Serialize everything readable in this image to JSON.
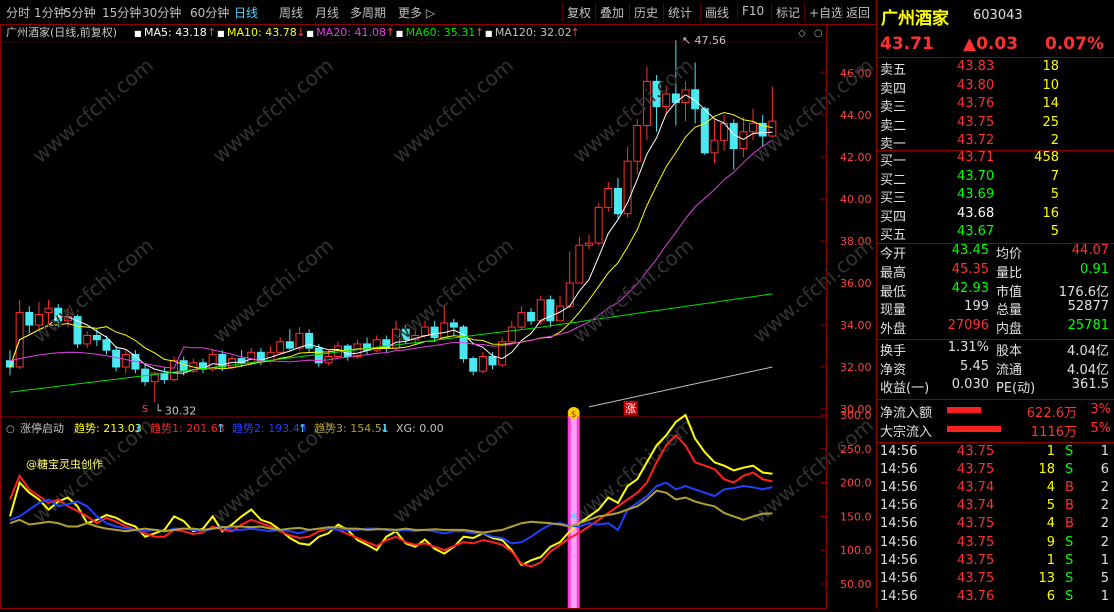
{
  "toolbar": {
    "periods": [
      "分时",
      "1分钟",
      "5分钟",
      "15分钟",
      "30分钟",
      "60分钟",
      "日线",
      "周线",
      "月线",
      "多周期",
      "更多"
    ],
    "active": "日线",
    "actions": [
      "复权",
      "叠加",
      "历史",
      "统计",
      "画线",
      "F10",
      "标记",
      "+自选",
      "返回"
    ]
  },
  "main_chart": {
    "title": "广州酒家(日线,前复权)",
    "ma": [
      {
        "label": "MA5: 43.18",
        "arrow": "↑",
        "color": "#ffffff"
      },
      {
        "label": "MA10: 43.78",
        "arrow": "↓",
        "color": "#ffff00"
      },
      {
        "label": "MA20: 41.08",
        "arrow": "↑",
        "color": "#e040e0"
      },
      {
        "label": "MA60: 35.31",
        "arrow": "↑",
        "color": "#00e000"
      },
      {
        "label": "MA120: 32.02",
        "arrow": "↑",
        "color": "#c0c0c0"
      }
    ],
    "y_ticks": [
      "46.00",
      "44.00",
      "42.00",
      "40.00",
      "38.00",
      "36.00",
      "34.00",
      "32.00",
      "30.00"
    ],
    "high_marker": "47.56",
    "low_marker": "30.32",
    "limit_up_marker": "涨",
    "s_marker": "S"
  },
  "indicator": {
    "name": "涨停启动",
    "lines": [
      {
        "label": "趋势: 213.03",
        "arrow": "↓",
        "color": "#ffff00"
      },
      {
        "label": "趋势1: 201.63",
        "arrow": "↑",
        "color": "#ff2020"
      },
      {
        "label": "趋势2: 193.45",
        "arrow": "↑",
        "color": "#2040ff"
      },
      {
        "label": "趋势3: 154.51",
        "arrow": "↓",
        "color": "#b0a030"
      },
      {
        "label": "XG: 0.00",
        "arrow": "",
        "color": "#c0c0c0"
      }
    ],
    "author": "@糖宝灵虫创作",
    "y_ticks": [
      "300.0",
      "250.0",
      "200.0",
      "150.0",
      "100.0",
      "50.00"
    ]
  },
  "stock": {
    "name": "广州酒家",
    "code": "603043",
    "price": "43.71",
    "change": "▲0.03",
    "pct": "0.07%"
  },
  "asks": [
    {
      "label": "卖五",
      "price": "43.83",
      "vol": "18"
    },
    {
      "label": "卖四",
      "price": "43.80",
      "vol": "10"
    },
    {
      "label": "卖三",
      "price": "43.76",
      "vol": "14"
    },
    {
      "label": "卖二",
      "price": "43.75",
      "vol": "25"
    },
    {
      "label": "卖一",
      "price": "43.72",
      "vol": "2"
    }
  ],
  "bids": [
    {
      "label": "买一",
      "price": "43.71",
      "vol": "458"
    },
    {
      "label": "买二",
      "price": "43.70",
      "vol": "7"
    },
    {
      "label": "买三",
      "price": "43.69",
      "vol": "5"
    },
    {
      "label": "买四",
      "price": "43.68",
      "vol": "16"
    },
    {
      "label": "买五",
      "price": "43.67",
      "vol": "5"
    }
  ],
  "stats": [
    {
      "l1": "今开",
      "v1": "43.45",
      "c1": "#00ff00",
      "l2": "均价",
      "v2": "44.07",
      "c2": "#ff3030"
    },
    {
      "l1": "最高",
      "v1": "45.35",
      "c1": "#ff3030",
      "l2": "量比",
      "v2": "0.91",
      "c2": "#00ff00"
    },
    {
      "l1": "最低",
      "v1": "42.93",
      "c1": "#00ff00",
      "l2": "市值",
      "v2": "176.6亿",
      "c2": "#e0e0e0"
    },
    {
      "l1": "现量",
      "v1": "199",
      "c1": "#e0e0e0",
      "l2": "总量",
      "v2": "52877",
      "c2": "#e0e0e0"
    },
    {
      "l1": "外盘",
      "v1": "27096",
      "c1": "#ff3030",
      "l2": "内盘",
      "v2": "25781",
      "c2": "#00ff00"
    }
  ],
  "stats2": [
    {
      "l1": "换手",
      "v1": "1.31%",
      "l2": "股本",
      "v2": "4.04亿"
    },
    {
      "l1": "净资",
      "v1": "5.45",
      "l2": "流通",
      "v2": "4.04亿"
    },
    {
      "l1": "收益(一)",
      "v1": "0.030",
      "l2": "PE(动)",
      "v2": "361.5"
    }
  ],
  "flows": [
    {
      "label": "净流入额",
      "value": "622.6万",
      "pct": "3%"
    },
    {
      "label": "大宗流入",
      "value": "1116万",
      "pct": "5%"
    }
  ],
  "ticks": [
    {
      "t": "14:56",
      "p": "43.75",
      "v": "1",
      "d": "S",
      "n": "1"
    },
    {
      "t": "14:56",
      "p": "43.75",
      "v": "18",
      "d": "S",
      "n": "6"
    },
    {
      "t": "14:56",
      "p": "43.74",
      "v": "4",
      "d": "B",
      "n": "2"
    },
    {
      "t": "14:56",
      "p": "43.74",
      "v": "5",
      "d": "B",
      "n": "2"
    },
    {
      "t": "14:56",
      "p": "43.75",
      "v": "4",
      "d": "B",
      "n": "2"
    },
    {
      "t": "14:56",
      "p": "43.75",
      "v": "9",
      "d": "S",
      "n": "2"
    },
    {
      "t": "14:56",
      "p": "43.75",
      "v": "1",
      "d": "S",
      "n": "1"
    },
    {
      "t": "14:56",
      "p": "43.75",
      "v": "13",
      "d": "S",
      "n": "5"
    },
    {
      "t": "14:56",
      "p": "43.76",
      "v": "6",
      "d": "S",
      "n": "1"
    }
  ],
  "chart_data": {
    "type": "candlestick",
    "price_axis": [
      30,
      46
    ],
    "candles": [
      [
        32.3,
        32.0,
        32.8,
        31.6
      ],
      [
        32.0,
        34.6,
        35.2,
        31.9
      ],
      [
        34.6,
        34.0,
        34.9,
        33.6
      ],
      [
        34.0,
        34.5,
        35.1,
        33.8
      ],
      [
        34.6,
        34.8,
        35.2,
        34.0
      ],
      [
        34.8,
        34.2,
        35.0,
        33.9
      ],
      [
        34.2,
        34.4,
        34.8,
        33.9
      ],
      [
        34.4,
        33.1,
        34.5,
        32.9
      ],
      [
        33.1,
        33.5,
        33.7,
        32.9
      ],
      [
        33.5,
        33.3,
        33.8,
        33.0
      ],
      [
        33.3,
        32.8,
        33.5,
        32.6
      ],
      [
        32.8,
        32.0,
        33.0,
        31.8
      ],
      [
        32.0,
        32.6,
        32.8,
        31.7
      ],
      [
        32.6,
        31.9,
        32.8,
        31.7
      ],
      [
        31.9,
        31.3,
        32.2,
        31.1
      ],
      [
        31.3,
        31.7,
        31.8,
        30.32
      ],
      [
        31.7,
        31.4,
        32.0,
        31.2
      ],
      [
        31.4,
        32.3,
        32.5,
        31.3
      ],
      [
        32.3,
        31.8,
        32.5,
        31.6
      ],
      [
        31.8,
        32.2,
        32.4,
        31.7
      ],
      [
        32.2,
        31.9,
        32.4,
        31.7
      ],
      [
        31.9,
        32.6,
        32.8,
        31.8
      ],
      [
        32.6,
        32.0,
        32.8,
        31.8
      ],
      [
        32.0,
        32.4,
        32.5,
        31.9
      ],
      [
        32.4,
        32.2,
        32.8,
        32.0
      ],
      [
        32.2,
        32.7,
        32.9,
        32.1
      ],
      [
        32.7,
        32.3,
        32.9,
        32.1
      ],
      [
        32.3,
        32.7,
        33.0,
        32.2
      ],
      [
        32.7,
        33.2,
        33.4,
        32.6
      ],
      [
        33.2,
        32.9,
        33.8,
        32.8
      ],
      [
        32.9,
        33.6,
        33.9,
        32.8
      ],
      [
        33.6,
        32.9,
        33.8,
        32.7
      ],
      [
        32.9,
        32.2,
        33.1,
        32.0
      ],
      [
        32.2,
        32.5,
        32.8,
        32.1
      ],
      [
        32.5,
        33.0,
        33.2,
        32.4
      ],
      [
        33.0,
        32.5,
        33.1,
        32.3
      ],
      [
        32.5,
        33.1,
        33.3,
        32.4
      ],
      [
        33.1,
        32.8,
        33.4,
        32.6
      ],
      [
        32.8,
        33.3,
        33.5,
        32.7
      ],
      [
        33.3,
        32.9,
        33.5,
        32.7
      ],
      [
        32.9,
        33.8,
        34.2,
        32.8
      ],
      [
        33.8,
        33.3,
        34.0,
        33.1
      ],
      [
        33.3,
        33.5,
        33.8,
        33.1
      ],
      [
        33.5,
        33.9,
        34.2,
        33.4
      ],
      [
        33.9,
        33.4,
        34.2,
        33.2
      ],
      [
        33.4,
        34.1,
        34.9,
        33.3
      ],
      [
        34.1,
        33.9,
        34.3,
        33.5
      ],
      [
        33.9,
        32.4,
        34.0,
        32.2
      ],
      [
        32.4,
        31.8,
        32.5,
        31.6
      ],
      [
        31.8,
        32.5,
        32.7,
        31.7
      ],
      [
        32.5,
        32.1,
        32.7,
        31.9
      ],
      [
        32.1,
        33.2,
        33.4,
        32.0
      ],
      [
        33.2,
        33.9,
        34.2,
        33.1
      ],
      [
        33.9,
        34.6,
        34.9,
        33.8
      ],
      [
        34.6,
        34.2,
        34.8,
        34.0
      ],
      [
        34.2,
        35.2,
        35.4,
        34.0
      ],
      [
        35.2,
        34.2,
        35.4,
        33.9
      ],
      [
        34.2,
        34.9,
        35.4,
        34.2
      ],
      [
        34.9,
        36.0,
        37.5,
        34.8
      ],
      [
        36.0,
        37.8,
        38.2,
        37.5
      ],
      [
        37.8,
        37.9,
        38.3,
        37.6
      ],
      [
        37.9,
        39.6,
        39.8,
        37.8
      ],
      [
        39.6,
        40.5,
        40.8,
        39.4
      ],
      [
        40.5,
        39.3,
        41.0,
        39.0
      ],
      [
        39.3,
        41.8,
        42.5,
        39.1
      ],
      [
        41.8,
        43.5,
        43.8,
        41.2
      ],
      [
        43.5,
        45.6,
        46.3,
        42.8
      ],
      [
        45.6,
        44.4,
        45.9,
        43.2
      ],
      [
        44.4,
        45.0,
        45.4,
        44.0
      ],
      [
        45.0,
        44.6,
        47.56,
        43.5
      ],
      [
        44.6,
        45.2,
        45.6,
        43.7
      ],
      [
        45.2,
        44.3,
        46.5,
        43.6
      ],
      [
        44.3,
        42.2,
        44.4,
        42.1
      ],
      [
        42.2,
        42.8,
        43.8,
        41.7
      ],
      [
        42.8,
        43.6,
        44.0,
        42.3
      ],
      [
        43.6,
        42.4,
        43.8,
        41.4
      ],
      [
        42.4,
        43.2,
        43.9,
        42.0
      ],
      [
        43.2,
        43.6,
        44.3,
        42.8
      ],
      [
        43.6,
        43.0,
        44.0,
        42.5
      ],
      [
        43.0,
        43.71,
        45.35,
        42.93
      ]
    ],
    "indicator_axis": [
      0,
      300
    ],
    "series": [
      {
        "name": "趋势",
        "color": "#ffff00",
        "values": [
          150,
          200,
          185,
          175,
          160,
          172,
          178,
          165,
          140,
          145,
          152,
          148,
          140,
          135,
          120,
          125,
          130,
          150,
          143,
          128,
          132,
          150,
          128,
          138,
          150,
          160,
          145,
          140,
          130,
          118,
          110,
          108,
          120,
          125,
          138,
          130,
          115,
          108,
          100,
          120,
          128,
          110,
          105,
          116,
          102,
          95,
          105,
          120,
          118,
          125,
          118,
          115,
          100,
          78,
          85,
          90,
          105,
          112,
          128,
          140,
          150,
          160,
          178,
          170,
          195,
          205,
          230,
          255,
          270,
          290,
          300,
          265,
          245,
          230,
          225,
          218,
          222,
          225,
          215,
          213.03
        ]
      },
      {
        "name": "趋势1",
        "color": "#ff2020",
        "values": [
          175,
          210,
          190,
          180,
          170,
          175,
          165,
          158,
          150,
          140,
          148,
          142,
          135,
          130,
          125,
          120,
          120,
          130,
          128,
          124,
          126,
          135,
          130,
          128,
          138,
          145,
          140,
          135,
          128,
          122,
          118,
          120,
          128,
          132,
          130,
          124,
          118,
          112,
          106,
          115,
          120,
          112,
          108,
          110,
          105,
          100,
          106,
          112,
          110,
          115,
          112,
          108,
          98,
          80,
          76,
          82,
          98,
          108,
          118,
          126,
          135,
          145,
          155,
          165,
          175,
          185,
          200,
          230,
          255,
          270,
          255,
          230,
          225,
          220,
          205,
          200,
          210,
          215,
          205,
          201.63
        ]
      },
      {
        "name": "趋势2",
        "color": "#2040ff",
        "values": [
          145,
          150,
          160,
          170,
          175,
          165,
          168,
          172,
          165,
          150,
          140,
          135,
          132,
          130,
          128,
          130,
          128,
          132,
          132,
          130,
          128,
          132,
          135,
          130,
          130,
          132,
          130,
          128,
          130,
          128,
          125,
          130,
          132,
          132,
          130,
          130,
          130,
          132,
          132,
          130,
          128,
          130,
          128,
          130,
          128,
          125,
          128,
          128,
          125,
          125,
          120,
          118,
          110,
          112,
          120,
          130,
          138,
          140,
          136,
          135,
          140,
          138,
          140,
          130,
          160,
          170,
          180,
          195,
          200,
          190,
          195,
          190,
          185,
          180,
          190,
          192,
          195,
          193,
          190,
          193.45
        ]
      },
      {
        "name": "趋势3",
        "color": "#b0a030",
        "values": [
          140,
          145,
          138,
          140,
          142,
          140,
          135,
          135,
          140,
          135,
          132,
          130,
          128,
          130,
          132,
          130,
          128,
          130,
          132,
          132,
          130,
          132,
          134,
          135,
          135,
          134,
          135,
          132,
          130,
          132,
          133,
          130,
          132,
          134,
          134,
          132,
          132,
          130,
          131,
          131,
          130,
          132,
          130,
          130,
          131,
          130,
          130,
          130,
          128,
          126,
          128,
          130,
          135,
          140,
          142,
          141,
          140,
          138,
          135,
          140,
          145,
          150,
          152,
          155,
          160,
          165,
          175,
          188,
          185,
          175,
          178,
          172,
          168,
          165,
          155,
          150,
          145,
          150,
          154,
          154.51
        ]
      }
    ]
  }
}
